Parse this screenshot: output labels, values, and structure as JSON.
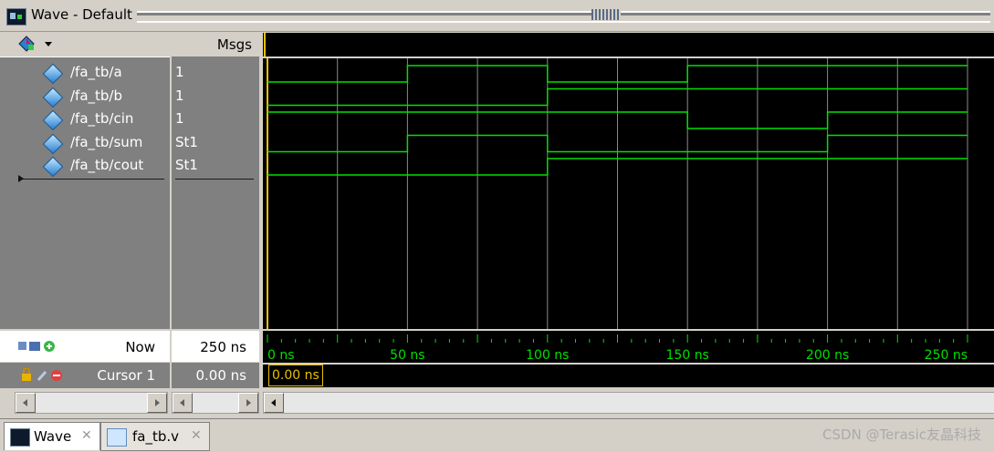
{
  "window": {
    "title": "Wave - Default"
  },
  "header": {
    "msgs_label": "Msgs"
  },
  "signals": [
    {
      "name": "/fa_tb/a",
      "value": "1"
    },
    {
      "name": "/fa_tb/b",
      "value": "1"
    },
    {
      "name": "/fa_tb/cin",
      "value": "1"
    },
    {
      "name": "/fa_tb/sum",
      "value": "St1"
    },
    {
      "name": "/fa_tb/cout",
      "value": "St1"
    }
  ],
  "status": {
    "now_label": "Now",
    "now_value": "250 ns",
    "cursor_label": "Cursor 1",
    "cursor_value": "0.00 ns",
    "cursor_readout": "0.00 ns"
  },
  "timeline": {
    "tick_labels": [
      "0 ns",
      "50 ns",
      "100 ns",
      "150 ns",
      "200 ns",
      "250 ns"
    ],
    "range_ns": [
      0,
      250
    ],
    "cursor_ns": 0
  },
  "waveforms": {
    "time_points_ns": [
      0,
      50,
      100,
      150,
      200,
      250
    ],
    "a": [
      0,
      1,
      0,
      1,
      1
    ],
    "b": [
      0,
      0,
      1,
      1,
      1
    ],
    "cin": [
      1,
      1,
      1,
      0,
      1
    ],
    "sum": [
      0,
      1,
      0,
      0,
      1
    ],
    "cout": [
      0,
      0,
      1,
      1,
      1
    ],
    "colors": {
      "signal": "#00e000",
      "grid": "#8a8a8a",
      "cursor": "#e8c000",
      "background": "#000000"
    }
  },
  "tabs": [
    {
      "label": "Wave",
      "active": true
    },
    {
      "label": "fa_tb.v",
      "active": false
    }
  ],
  "watermark": "CSDN @Terasic友晶科技"
}
